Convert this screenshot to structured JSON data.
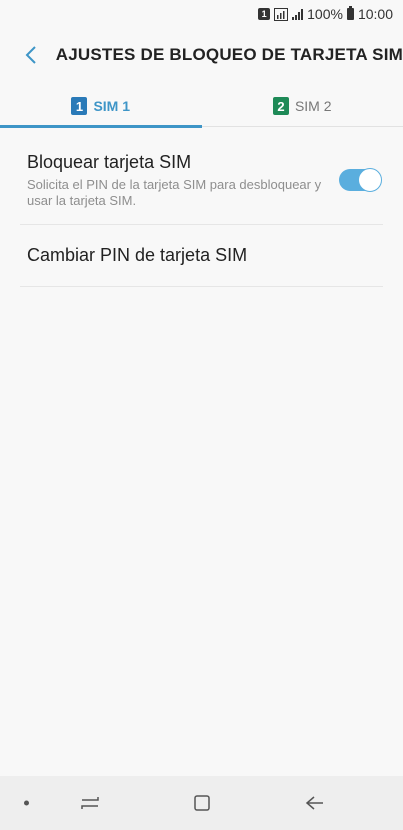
{
  "status_bar": {
    "sim_badge": "1",
    "battery": "100%",
    "time": "10:00"
  },
  "header": {
    "title": "AJUSTES DE BLOQUEO DE TARJETA SIM",
    "back_icon": "chevron-left-icon"
  },
  "tabs": [
    {
      "num": "1",
      "label": "SIM 1",
      "color": "#2a7ab8",
      "active": true
    },
    {
      "num": "2",
      "label": "SIM 2",
      "color": "#1e8a57",
      "active": false
    }
  ],
  "settings": {
    "lock_sim": {
      "title": "Bloquear tarjeta SIM",
      "subtitle": "Solicita el PIN de la tarjeta SIM para desbloquear y usar la tarjeta SIM.",
      "enabled": true
    },
    "change_pin": {
      "title": "Cambiar PIN de tarjeta SIM"
    }
  },
  "navbar": {
    "icons": [
      "recents-icon",
      "home-icon",
      "back-arrow-icon"
    ]
  },
  "colors": {
    "accent": "#3e95c7",
    "toggle_on": "#5aaede"
  }
}
